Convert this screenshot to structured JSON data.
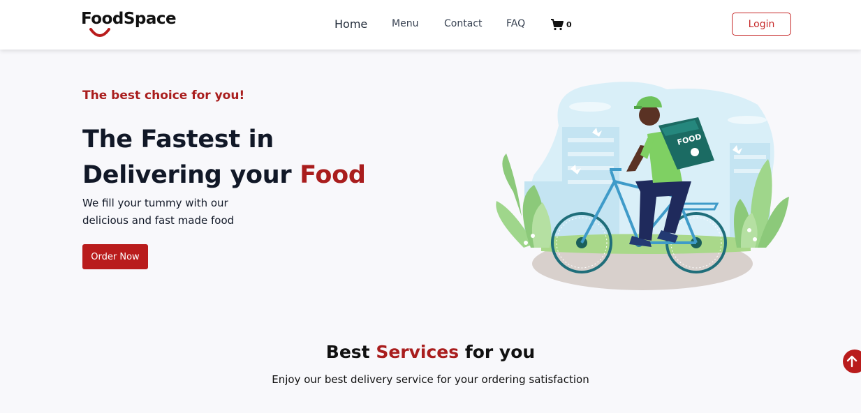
{
  "brand": {
    "name": "FoodSpace",
    "accent_color": "#b91c1c"
  },
  "nav": {
    "home": "Home",
    "menu": "Menu",
    "contact": "Contact",
    "faq": "FAQ",
    "cart_count": "0",
    "cart_icon": "cart-icon",
    "login": "Login"
  },
  "hero": {
    "tagline": "The best choice for you!",
    "headline_line1": "The Fastest in",
    "headline_line2_prefix": "Delivering your ",
    "headline_line2_accent": "Food",
    "subtext": "We fill your tummy with our delicious and fast made food",
    "cta": "Order Now",
    "illustration_bag_label": "FOOD"
  },
  "services": {
    "title_prefix": "Best ",
    "title_accent": "Services",
    "title_suffix": " for you",
    "subtitle": "Enjoy our best delivery service for your ordering satisfaction"
  },
  "scroll_top_icon": "arrow-up-icon"
}
